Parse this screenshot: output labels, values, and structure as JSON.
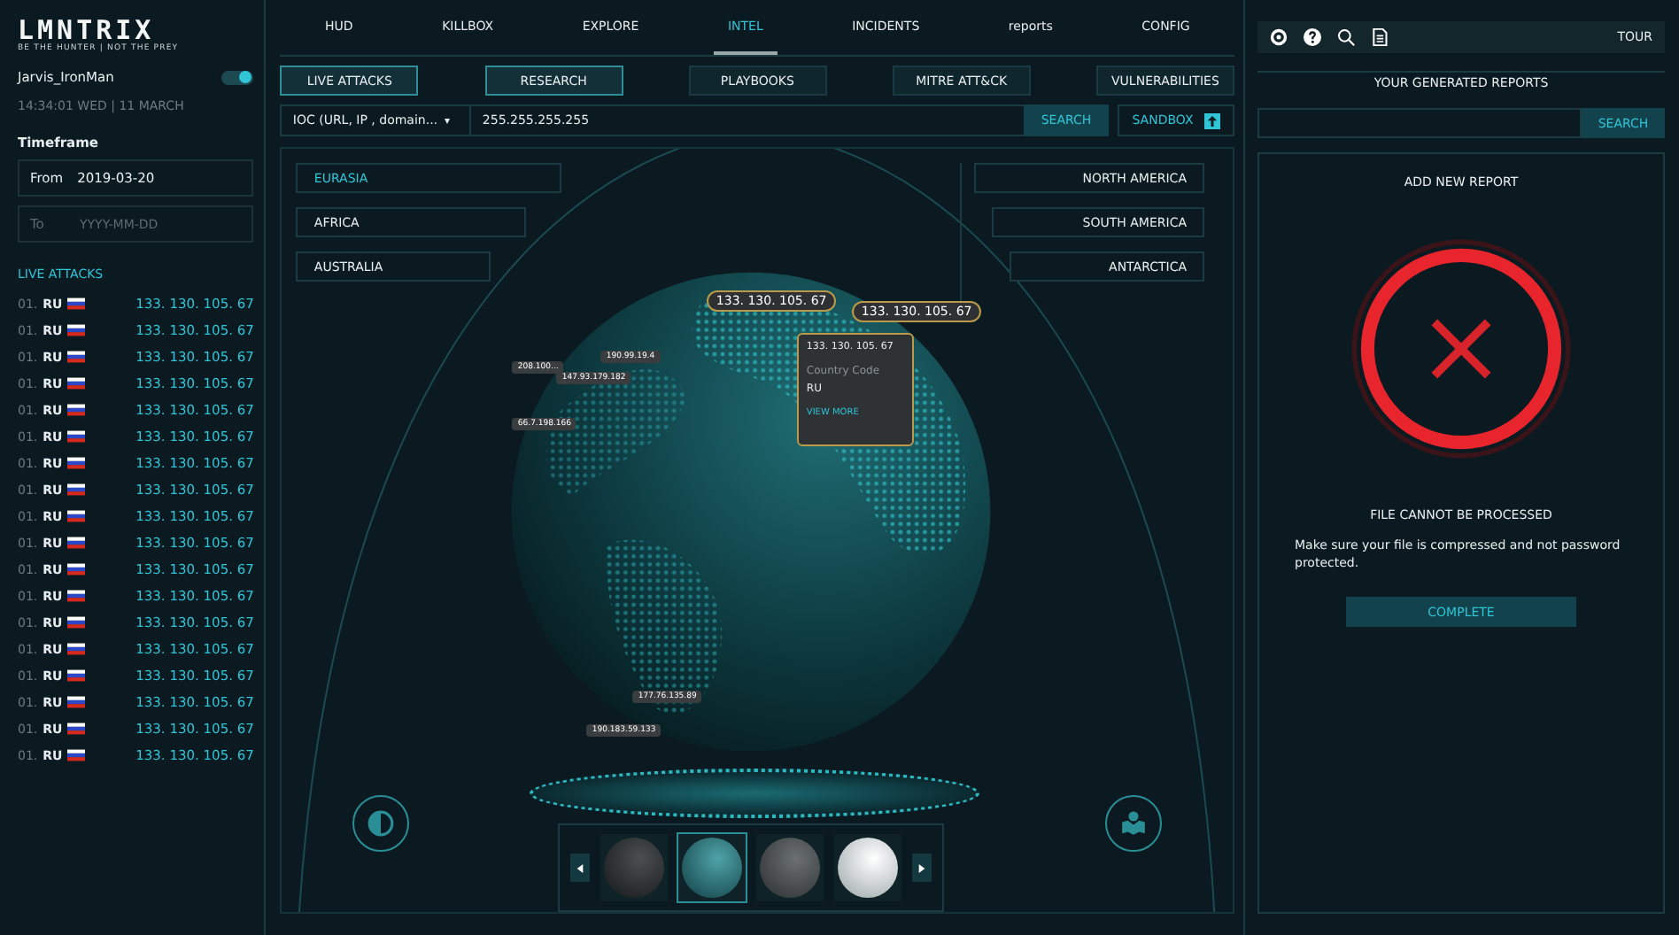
{
  "brand": {
    "logo": "LMNTRIX",
    "tagline": "BE THE HUNTER | NOT THE PREY"
  },
  "user": {
    "name": "Jarvis_IronMan",
    "online": true,
    "datetime": "14:34:01 WED | 11 MARCH"
  },
  "timeframe": {
    "title": "Timeframe",
    "from": {
      "label": "From",
      "value": "2019-03-20"
    },
    "to": {
      "label": "To",
      "placeholder": "YYYY-MM-DD"
    }
  },
  "live_attacks": {
    "title": "LIVE ATTACKS",
    "rows": [
      {
        "index": "01.",
        "country": "RU",
        "ip": "133. 130. 105. 67"
      },
      {
        "index": "01.",
        "country": "RU",
        "ip": "133. 130. 105. 67"
      },
      {
        "index": "01.",
        "country": "RU",
        "ip": "133. 130. 105. 67"
      },
      {
        "index": "01.",
        "country": "RU",
        "ip": "133. 130. 105. 67"
      },
      {
        "index": "01.",
        "country": "RU",
        "ip": "133. 130. 105. 67"
      },
      {
        "index": "01.",
        "country": "RU",
        "ip": "133. 130. 105. 67"
      },
      {
        "index": "01.",
        "country": "RU",
        "ip": "133. 130. 105. 67"
      },
      {
        "index": "01.",
        "country": "RU",
        "ip": "133. 130. 105. 67"
      },
      {
        "index": "01.",
        "country": "RU",
        "ip": "133. 130. 105. 67"
      },
      {
        "index": "01.",
        "country": "RU",
        "ip": "133. 130. 105. 67"
      },
      {
        "index": "01.",
        "country": "RU",
        "ip": "133. 130. 105. 67"
      },
      {
        "index": "01.",
        "country": "RU",
        "ip": "133. 130. 105. 67"
      },
      {
        "index": "01.",
        "country": "RU",
        "ip": "133. 130. 105. 67"
      },
      {
        "index": "01.",
        "country": "RU",
        "ip": "133. 130. 105. 67"
      },
      {
        "index": "01.",
        "country": "RU",
        "ip": "133. 130. 105. 67"
      },
      {
        "index": "01.",
        "country": "RU",
        "ip": "133. 130. 105. 67"
      },
      {
        "index": "01.",
        "country": "RU",
        "ip": "133. 130. 105. 67"
      },
      {
        "index": "01.",
        "country": "RU",
        "ip": "133. 130. 105. 67"
      }
    ]
  },
  "nav": [
    {
      "label": "HUD",
      "selected": false
    },
    {
      "label": "KILLBOX",
      "selected": false
    },
    {
      "label": "EXPLORE",
      "selected": false
    },
    {
      "label": "INTEL",
      "selected": true
    },
    {
      "label": "INCIDENTS",
      "selected": false
    },
    {
      "label": "reports",
      "selected": false
    },
    {
      "label": "CONFIG",
      "selected": false
    }
  ],
  "toolbar": {
    "tour": "TOUR"
  },
  "tabs": [
    {
      "label": "LIVE ATTACKS",
      "selected": true
    },
    {
      "label": "RESEARCH",
      "selected": true
    },
    {
      "label": "PLAYBOOKS",
      "selected": false
    },
    {
      "label": "MITRE ATT&CK",
      "selected": false
    },
    {
      "label": "VULNERABILITIES",
      "selected": false
    }
  ],
  "search": {
    "type": "IOC (URL, IP , domain...",
    "caret": "▾",
    "value": "255.255.255.255",
    "button": "SEARCH",
    "sandbox": "SANDBOX"
  },
  "regions_left": [
    {
      "label": "EURASIA",
      "selected": true
    },
    {
      "label": "AFRICA",
      "selected": false
    },
    {
      "label": "AUSTRALIA",
      "selected": false
    }
  ],
  "regions_right": [
    {
      "label": "NORTH AMERICA",
      "selected": false
    },
    {
      "label": "SOUTH AMERICA",
      "selected": false
    },
    {
      "label": "ANTARCTICA",
      "selected": false
    }
  ],
  "globe": {
    "tags": [
      {
        "ip": "133. 130. 105. 67",
        "kind": "large"
      },
      {
        "ip": "133. 130. 105. 67",
        "kind": "large"
      },
      {
        "ip": "208.100...",
        "kind": "small"
      },
      {
        "ip": "190.99.19.4",
        "kind": "small"
      },
      {
        "ip": "147.93.179.182",
        "kind": "small"
      },
      {
        "ip": "66.7.198.166",
        "kind": "small"
      },
      {
        "ip": "177.76.135.89",
        "kind": "small"
      },
      {
        "ip": "190.183.59.133",
        "kind": "small"
      }
    ],
    "tooltip": {
      "ip": "133. 130. 105. 67",
      "label": "Country Code",
      "value": "RU",
      "link": "VIEW MORE"
    },
    "thumbnails": [
      {
        "kind": "dark",
        "selected": false
      },
      {
        "kind": "teal",
        "selected": true
      },
      {
        "kind": "grey",
        "selected": false
      },
      {
        "kind": "white",
        "selected": false
      }
    ]
  },
  "reports": {
    "title": "YOUR GENERATED REPORTS",
    "button": "SEARCH",
    "add_new": "ADD NEW REPORT",
    "error_title": "FILE CANNOT BE PROCESSED",
    "message": "Make sure your file is compressed and not password protected.",
    "action": "COMPLETE"
  }
}
